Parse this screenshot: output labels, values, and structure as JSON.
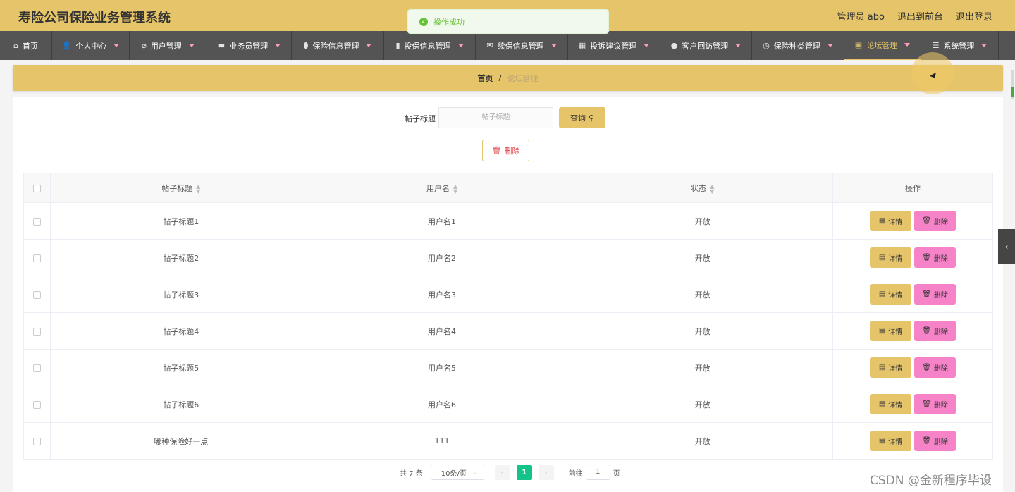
{
  "header": {
    "title": "寿险公司保险业务管理系统",
    "links": [
      "管理员 abo",
      "退出到前台",
      "退出登录"
    ]
  },
  "toast": {
    "text": "操作成功"
  },
  "nav": [
    {
      "label": "首页",
      "icon": "home-icon",
      "glyph": "⌂",
      "caret": false,
      "width": 74
    },
    {
      "label": "个人中心",
      "icon": "user-icon",
      "glyph": "👤",
      "caret": true,
      "width": 110
    },
    {
      "label": "用户管理",
      "icon": "users-icon",
      "glyph": "⌀",
      "caret": true,
      "width": 110
    },
    {
      "label": "业务员管理",
      "icon": "briefcase-icon",
      "glyph": "▬",
      "caret": true,
      "width": 120
    },
    {
      "label": "保险信息管理",
      "icon": "microphone-icon",
      "glyph": "⬮",
      "caret": true,
      "width": 131
    },
    {
      "label": "投保信息管理",
      "icon": "bar-chart-icon",
      "glyph": "▮",
      "caret": true,
      "width": 130
    },
    {
      "label": "续保信息管理",
      "icon": "ticket-icon",
      "glyph": "✉",
      "caret": true,
      "width": 131
    },
    {
      "label": "投诉建议管理",
      "icon": "grid-icon",
      "glyph": "▦",
      "caret": true,
      "width": 131
    },
    {
      "label": "客户回访管理",
      "icon": "location-icon",
      "glyph": "●",
      "caret": true,
      "width": 130
    },
    {
      "label": "保险种类管理",
      "icon": "clock-icon",
      "glyph": "◷",
      "caret": true,
      "width": 131
    },
    {
      "label": "论坛管理",
      "icon": "clipboard-icon",
      "glyph": "▣",
      "caret": true,
      "width": 109,
      "active": true
    },
    {
      "label": "系统管理",
      "icon": "list-icon",
      "glyph": "☰",
      "caret": true,
      "width": 110
    }
  ],
  "breadcrumb": {
    "home": "首页",
    "separator": "/",
    "current": "论坛管理"
  },
  "search": {
    "label": "帖子标题",
    "placeholder": "帖子标题",
    "button": "查询"
  },
  "toolbar": {
    "delete_label": "删除"
  },
  "table": {
    "columns": [
      "帖子标题",
      "用户名",
      "状态",
      "操作"
    ],
    "rows": [
      {
        "title": "帖子标题1",
        "user": "用户名1",
        "status": "开放"
      },
      {
        "title": "帖子标题2",
        "user": "用户名2",
        "status": "开放"
      },
      {
        "title": "帖子标题3",
        "user": "用户名3",
        "status": "开放"
      },
      {
        "title": "帖子标题4",
        "user": "用户名4",
        "status": "开放"
      },
      {
        "title": "帖子标题5",
        "user": "用户名5",
        "status": "开放"
      },
      {
        "title": "帖子标题6",
        "user": "用户名6",
        "status": "开放"
      },
      {
        "title": "哪种保险好一点",
        "user": "111",
        "status": "开放"
      }
    ],
    "detail_label": "详情",
    "delete_label": "删除"
  },
  "pagination": {
    "total": "共 7 条",
    "page_size": "10条/页",
    "current_page": "1",
    "goto_label": "前往",
    "goto_value": "1",
    "page_suffix": "页"
  },
  "watermark": "CSDN @金新程序毕设",
  "colors": {
    "accent": "#e6c56a",
    "nav_bg": "#545454",
    "delete_pink": "#f683c8",
    "page_active": "#13c48a",
    "success": "#67c23a"
  }
}
